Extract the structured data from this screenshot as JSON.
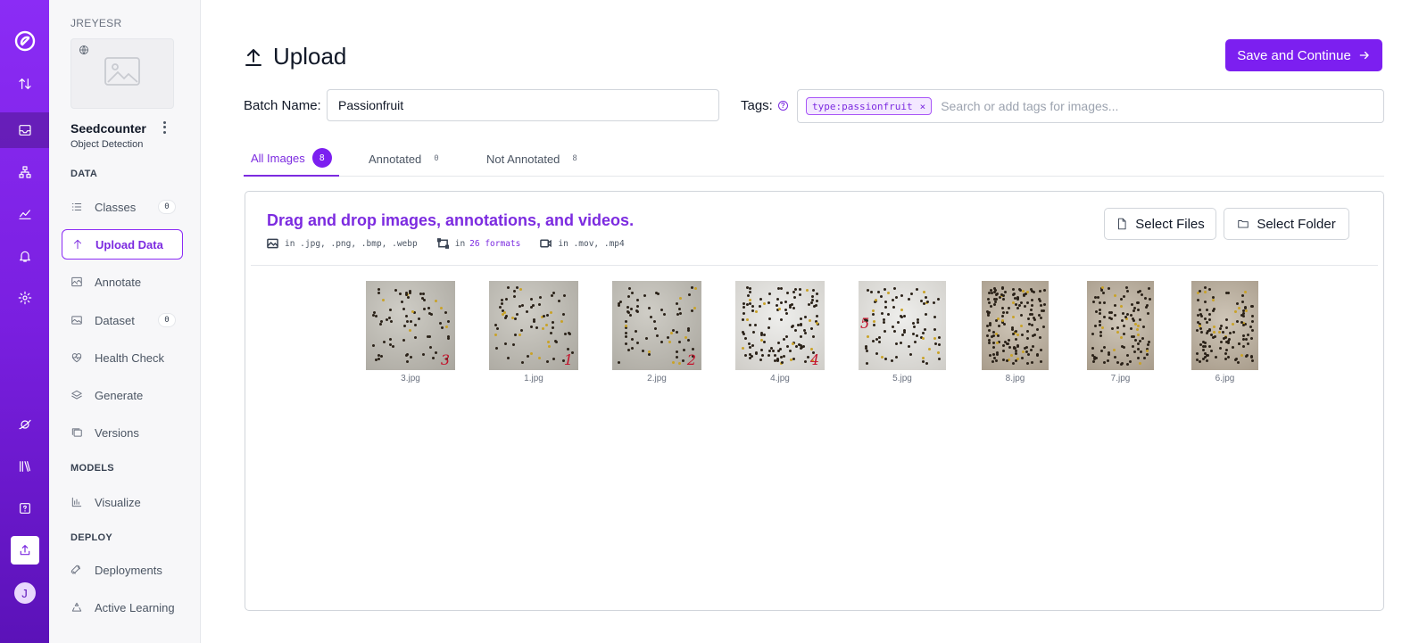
{
  "workspace": {
    "name": "JREYESR"
  },
  "project": {
    "title": "Seedcounter",
    "type": "Object Detection"
  },
  "sidebar": {
    "sections": {
      "data": "DATA",
      "models": "MODELS",
      "deploy": "DEPLOY"
    },
    "items": [
      {
        "label": "Classes",
        "count": "0",
        "icon": "list-icon"
      },
      {
        "label": "Upload Data",
        "icon": "upload-arrow-icon",
        "active": true
      },
      {
        "label": "Annotate",
        "icon": "annotate-image-icon"
      },
      {
        "label": "Dataset",
        "count": "0",
        "icon": "images-icon"
      },
      {
        "label": "Health Check",
        "icon": "heart-pulse-icon"
      },
      {
        "label": "Generate",
        "icon": "layers-icon"
      },
      {
        "label": "Versions",
        "icon": "versions-icon"
      },
      {
        "label": "Visualize",
        "icon": "chart-icon"
      },
      {
        "label": "Deployments",
        "icon": "rocket-icon"
      },
      {
        "label": "Active Learning",
        "icon": "recycle-icon"
      }
    ]
  },
  "rail": {
    "avatar_initial": "J"
  },
  "page": {
    "title": "Upload",
    "save_label": "Save and Continue"
  },
  "batch": {
    "label": "Batch Name:",
    "value": "Passionfruit"
  },
  "tags": {
    "label": "Tags:",
    "help": "?",
    "chip": "type:passionfruit",
    "chip_remove": "×",
    "placeholder": "Search or add tags for images..."
  },
  "tabs": [
    {
      "label": "All Images",
      "count": "8"
    },
    {
      "label": "Annotated",
      "count": "0"
    },
    {
      "label": "Not Annotated",
      "count": "8"
    }
  ],
  "dropzone": {
    "title": "Drag and drop images, annotations, and videos.",
    "images_formats": "in .jpg, .png, .bmp, .webp",
    "annotations_prefix": "in",
    "annotations_formats": "26 formats",
    "videos_formats": "in .mov, .mp4",
    "select_files": "Select Files",
    "select_folder": "Select Folder"
  },
  "images": [
    {
      "name": "3.jpg",
      "mark": "3"
    },
    {
      "name": "1.jpg",
      "mark": "1"
    },
    {
      "name": "2.jpg",
      "mark": "2"
    },
    {
      "name": "4.jpg",
      "mark": "4"
    },
    {
      "name": "5.jpg",
      "mark": "5"
    },
    {
      "name": "8.jpg",
      "mark": ""
    },
    {
      "name": "7.jpg",
      "mark": ""
    },
    {
      "name": "6.jpg",
      "mark": ""
    }
  ],
  "colors": {
    "accent": "#7c1ff0",
    "rail_top": "#8b2cf5",
    "rail_bottom": "#5b12b8"
  }
}
